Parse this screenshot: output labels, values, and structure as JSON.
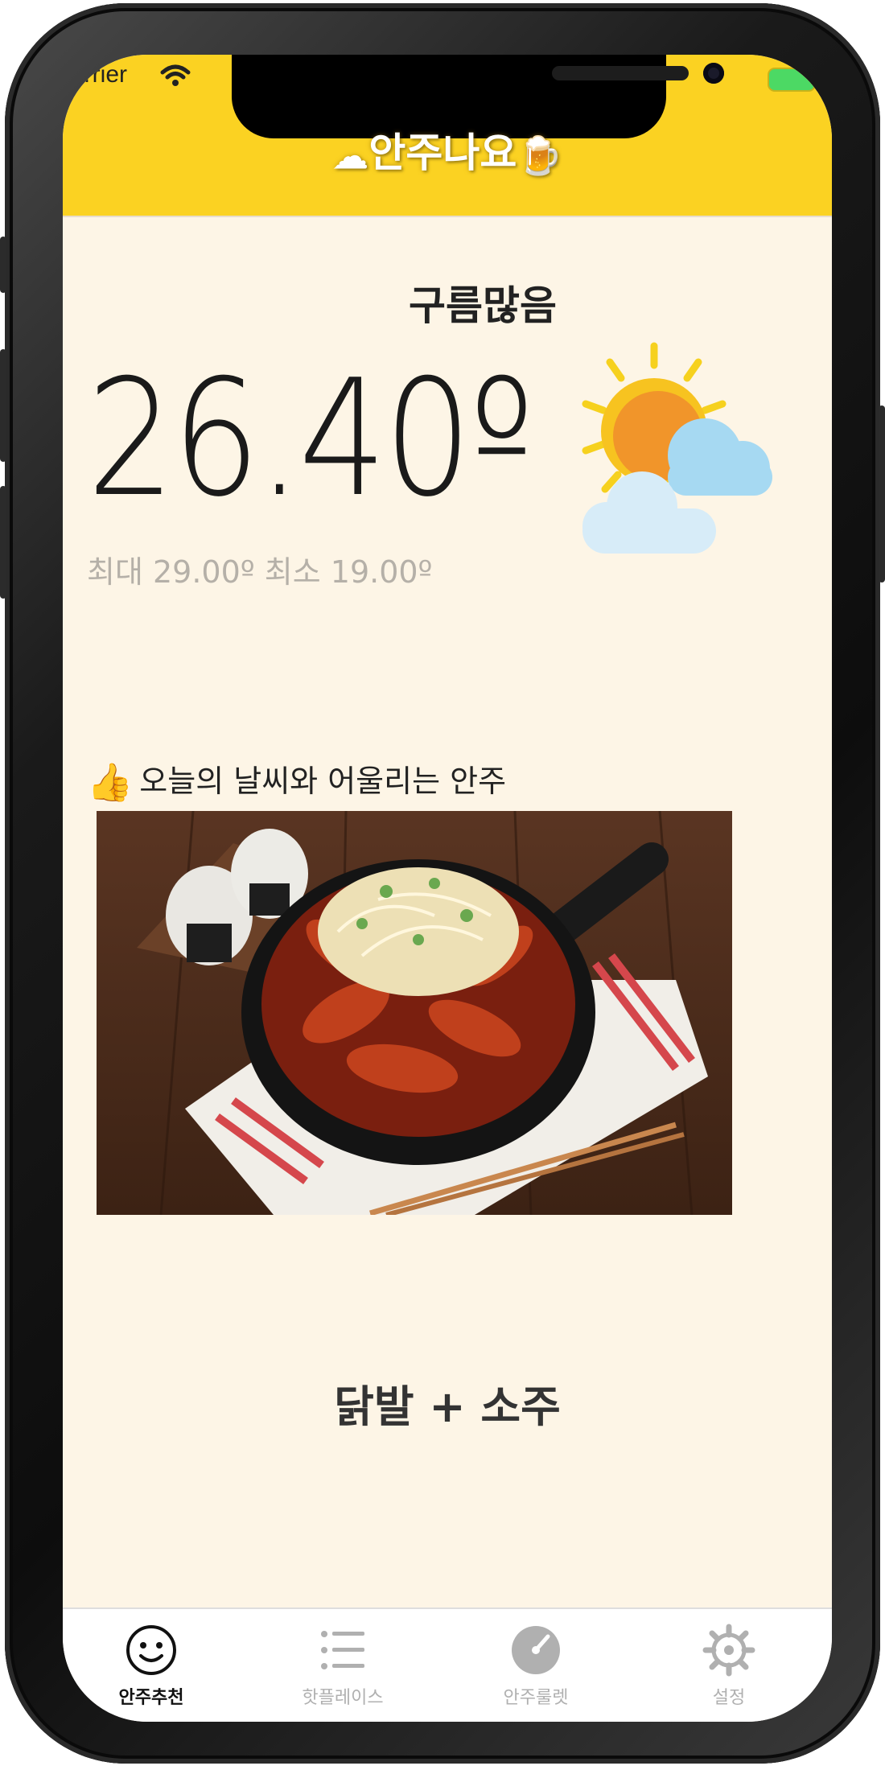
{
  "status": {
    "carrier": "arrier"
  },
  "header": {
    "title": "안주나요",
    "title_emoji_left": "☁",
    "title_emoji_right": "🍺"
  },
  "weather": {
    "condition": "구름많음",
    "temperature": "26.40º",
    "range": "최대 29.00º 최소 19.00º",
    "icon": "sun-behind-clouds"
  },
  "recommendation": {
    "label_emoji": "👍",
    "label": "오늘의 날씨와 어울리는 안주",
    "food_name": "닭발 + 소주",
    "photo": "spicy-chicken-feet-skillet"
  },
  "tabs": [
    {
      "label": "안주추천",
      "icon": "smiley-icon",
      "active": true
    },
    {
      "label": "핫플레이스",
      "icon": "list-icon",
      "active": false
    },
    {
      "label": "안주룰렛",
      "icon": "gauge-icon",
      "active": false
    },
    {
      "label": "설정",
      "icon": "gear-icon",
      "active": false
    }
  ],
  "colors": {
    "header": "#fbd222",
    "background": "#fdf5e6",
    "active_tab": "#111111",
    "inactive_tab": "#b0b0b0"
  }
}
